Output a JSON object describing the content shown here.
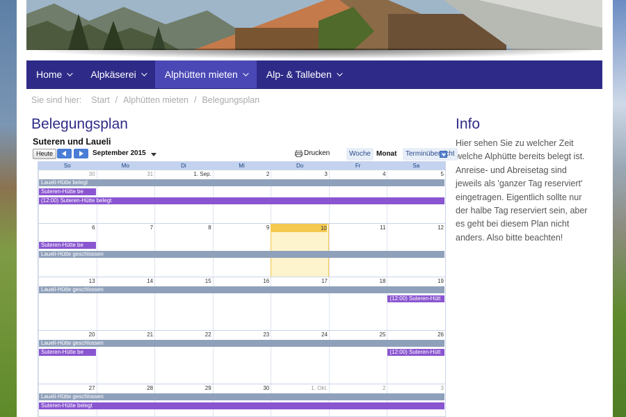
{
  "nav": {
    "items": [
      {
        "label": "Home"
      },
      {
        "label": "Alpkäserei"
      },
      {
        "label": "Alphütten mieten"
      },
      {
        "label": "Alp- & Talleben"
      }
    ]
  },
  "breadcrumb": {
    "label": "Sie sind hier:",
    "items": [
      "Start",
      "Alphütten mieten",
      "Belegungsplan"
    ],
    "separator": "/"
  },
  "main": {
    "title": "Belegungsplan"
  },
  "info": {
    "title": "Info",
    "text": "Hier sehen Sie zu welcher Zeit welche Alphütte  bereits belegt ist. Anreise- und Abreisetag sind jeweils als 'ganzer Tag reserviert' eingetragen. Eigentlich sollte nur der halbe Tag reserviert sein, aber es geht bei diesem Plan nicht anders. Also bitte beachten!"
  },
  "calendar": {
    "title": "Suteren und Laueli",
    "today_button": "Heute",
    "month_label": "September 2015",
    "print_label": "Drucken",
    "tabs": {
      "week": "Woche",
      "month": "Monat",
      "agenda": "Terminübersicht"
    },
    "weekdays": [
      "So",
      "Mo",
      "Di",
      "Mi",
      "Do",
      "Fr",
      "Sa"
    ],
    "weeks": [
      {
        "days": [
          "30",
          "31",
          "1. Sep.",
          "2",
          "3",
          "4",
          "5"
        ],
        "other": [
          true,
          true,
          false,
          false,
          false,
          false,
          false
        ],
        "events": [
          {
            "text": "Laueli-Hütte belegt",
            "color": "grey",
            "start": 0,
            "span": 7,
            "row": 0
          },
          {
            "text": "Suteren-Hütte be",
            "color": "purple",
            "start": 0,
            "span": 1,
            "row": 1
          },
          {
            "text": "(12:00) Suteren-Hütte belegt",
            "color": "purple",
            "start": 0,
            "span": 7,
            "row": 2
          }
        ]
      },
      {
        "days": [
          "6",
          "7",
          "8",
          "9",
          "10",
          "11",
          "12"
        ],
        "other": [
          false,
          false,
          false,
          false,
          false,
          false,
          false
        ],
        "today": 4,
        "events": [
          {
            "text": "Suteren-Hütte be",
            "color": "purple",
            "start": 0,
            "span": 1,
            "row": 1
          },
          {
            "text": "Laueli-Hütte geschlossen",
            "color": "grey",
            "start": 0,
            "span": 7,
            "row": 2
          }
        ]
      },
      {
        "days": [
          "13",
          "14",
          "15",
          "16",
          "17",
          "18",
          "19"
        ],
        "other": [
          false,
          false,
          false,
          false,
          false,
          false,
          false
        ],
        "events": [
          {
            "text": "Laueli-Hütte geschlossen",
            "color": "grey",
            "start": 0,
            "span": 7,
            "row": 0
          },
          {
            "text": "(12:00) Suteren-Hütt",
            "color": "purple",
            "start": 6,
            "span": 1,
            "row": 1
          }
        ]
      },
      {
        "days": [
          "20",
          "21",
          "22",
          "23",
          "24",
          "25",
          "26"
        ],
        "other": [
          false,
          false,
          false,
          false,
          false,
          false,
          false
        ],
        "events": [
          {
            "text": "Laueli-Hütte geschlossen",
            "color": "grey",
            "start": 0,
            "span": 7,
            "row": 0
          },
          {
            "text": "Suteren-Hütte be",
            "color": "purple",
            "start": 0,
            "span": 1,
            "row": 1
          },
          {
            "text": "(12:00) Suteren-Hütt",
            "color": "purple",
            "start": 6,
            "span": 1,
            "row": 1
          }
        ]
      },
      {
        "days": [
          "27",
          "28",
          "29",
          "30",
          "1. Okt.",
          "2",
          "3"
        ],
        "other": [
          false,
          false,
          false,
          false,
          true,
          true,
          true
        ],
        "events": [
          {
            "text": "Laueli-Hütte geschlossen",
            "color": "grey",
            "start": 0,
            "span": 7,
            "row": 0
          },
          {
            "text": "Suteren-Hütte belegt",
            "color": "purple",
            "start": 0,
            "span": 7,
            "row": 1
          }
        ]
      }
    ]
  },
  "colors": {
    "nav_bg": "#2e2b88",
    "nav_active": "#4a48b5",
    "title": "#2e2b88",
    "event_grey": "#8fa0ba",
    "event_purple": "#8a55d0",
    "today": "#fdf3cc"
  }
}
